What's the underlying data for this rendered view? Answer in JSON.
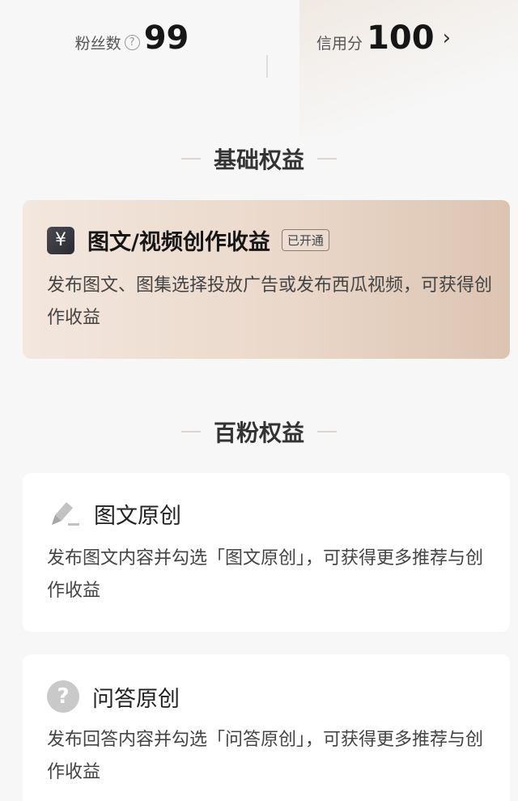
{
  "stats": {
    "fans": {
      "label": "粉丝数",
      "value": "99"
    },
    "credit": {
      "label": "信用分",
      "value": "100"
    }
  },
  "sections": {
    "basic": {
      "title": "基础权益",
      "card": {
        "icon": "yuan-icon",
        "icon_glyph": "¥",
        "title": "图文/视频创作收益",
        "badge": "已开通",
        "desc": "发布图文、图集选择投放广告或发布西瓜视频，可获得创作收益"
      }
    },
    "hundred": {
      "title": "百粉权益",
      "cards": [
        {
          "icon": "pen-icon",
          "title": "图文原创",
          "desc": "发布图文内容并勾选「图文原创」，可获得更多推荐与创作收益"
        },
        {
          "icon": "question-icon",
          "icon_glyph": "?",
          "title": "问答原创",
          "desc": "发布回答内容并勾选「问答原创」，可获得更多推荐与创作收益"
        }
      ]
    }
  },
  "colors": {
    "featured_gradient_start": "#f3e7de",
    "featured_gradient_end": "#dcc4b2",
    "background": "#f7f7f7"
  }
}
